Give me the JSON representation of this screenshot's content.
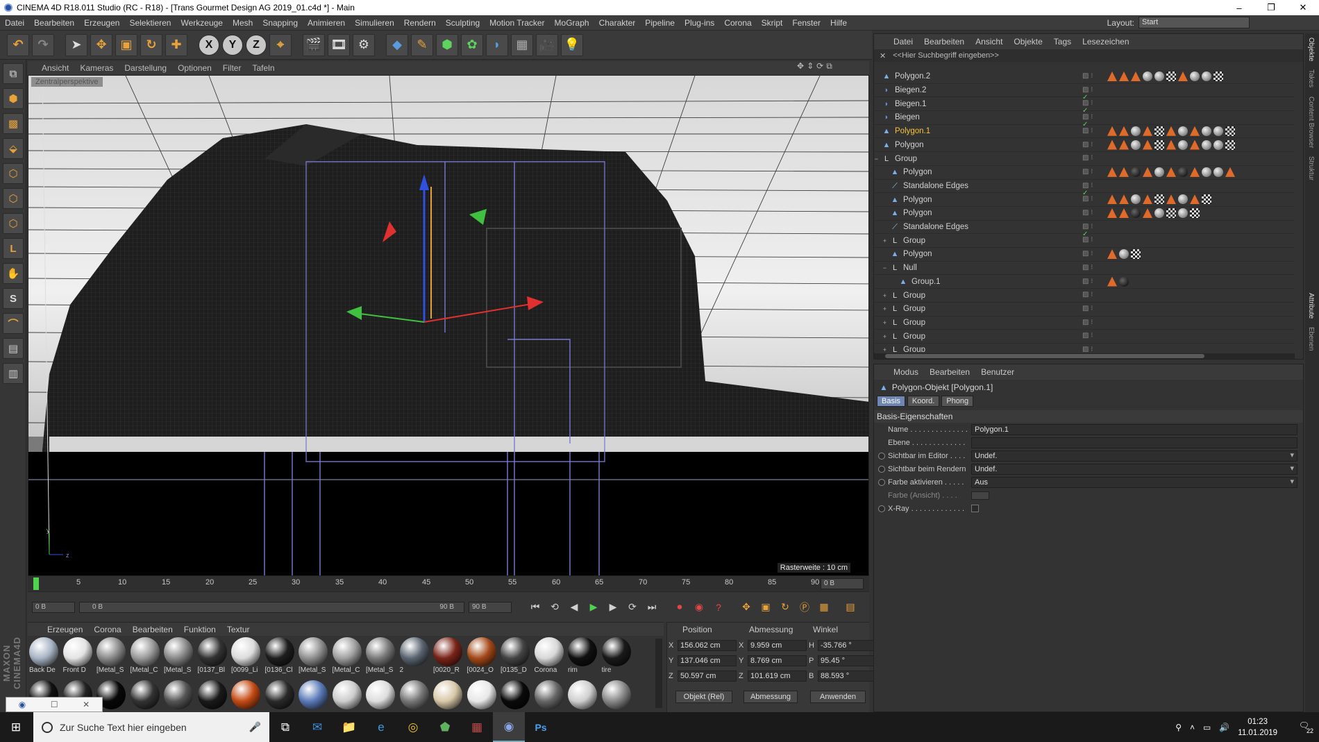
{
  "window": {
    "title": "CINEMA 4D R18.011 Studio (RC - R18) - [Trans Gourmet Design AG 2019_01.c4d *] - Main",
    "minimize": "–",
    "maximize": "❐",
    "close": "✕"
  },
  "menubar": {
    "items": [
      "Datei",
      "Bearbeiten",
      "Erzeugen",
      "Selektieren",
      "Werkzeuge",
      "Mesh",
      "Snapping",
      "Animieren",
      "Simulieren",
      "Rendern",
      "Sculpting",
      "Motion Tracker",
      "MoGraph",
      "Charakter",
      "Pipeline",
      "Plug-ins",
      "Corona",
      "Skript",
      "Fenster",
      "Hilfe"
    ],
    "layout_label": "Layout:",
    "layout_value": "Start"
  },
  "toolbar": {
    "axis_x": "X",
    "axis_y": "Y",
    "axis_z": "Z"
  },
  "viewport": {
    "menu": [
      "Ansicht",
      "Kameras",
      "Darstellung",
      "Optionen",
      "Filter",
      "Tafeln"
    ],
    "label": "Zentralperspektive",
    "raster": "Rasterweite : 10 cm"
  },
  "timeline": {
    "ticks": [
      "0",
      "5",
      "10",
      "15",
      "20",
      "25",
      "30",
      "35",
      "40",
      "45",
      "50",
      "55",
      "60",
      "65",
      "70",
      "75",
      "80",
      "85",
      "90"
    ],
    "frame_end": "0 B",
    "start_field": "0 B",
    "range_start": "0 B",
    "range_end": "90 B",
    "end_field": "90 B"
  },
  "materials": {
    "menu": [
      "Erzeugen",
      "Corona",
      "Bearbeiten",
      "Funktion",
      "Textur"
    ],
    "items": [
      {
        "name": "Back De",
        "color": "#a8b4c4"
      },
      {
        "name": "Front D",
        "color": "#e4e4e4"
      },
      {
        "name": "[Metal_S",
        "color": "#8a8a8a"
      },
      {
        "name": "[Metal_C",
        "color": "#9a9a9a"
      },
      {
        "name": "[Metal_S",
        "color": "#888888"
      },
      {
        "name": "[0137_Bl",
        "color": "#333333"
      },
      {
        "name": "[0099_Li",
        "color": "#dcdcdc"
      },
      {
        "name": "[0136_Cl",
        "color": "#1e1e1e"
      },
      {
        "name": "[Metal_S",
        "color": "#909090"
      },
      {
        "name": "[Metal_C",
        "color": "#a0a0a0"
      },
      {
        "name": "[Metal_S",
        "color": "#7a7a7a"
      },
      {
        "name": "2",
        "color": "#5a6470"
      },
      {
        "name": "[0020_R",
        "color": "#7a2418"
      },
      {
        "name": "[0024_O",
        "color": "#a44818"
      },
      {
        "name": "[0135_D",
        "color": "#444444"
      },
      {
        "name": "Corona",
        "color": "#d8d8d8"
      },
      {
        "name": "rim",
        "color": "#101010"
      },
      {
        "name": "tire",
        "color": "#1a1a1a"
      }
    ],
    "row2_colors": [
      "#111111",
      "#222222",
      "#080808",
      "#333333",
      "#555555",
      "#1a1a1a",
      "#c44a14",
      "#2a2a2a",
      "#5a7ab8",
      "#cccccc",
      "#dddddd",
      "#777777",
      "#d8c8a8",
      "#e8e8e8",
      "#0a0a0a",
      "#666666",
      "#cfcfcf",
      "#888888"
    ]
  },
  "coords": {
    "headers": [
      "Position",
      "Abmessung",
      "Winkel"
    ],
    "rows": [
      {
        "axis": "X",
        "pos": "156.062 cm",
        "size_axis": "X",
        "size": "9.959 cm",
        "rot_axis": "H",
        "rot": "-35.766 °"
      },
      {
        "axis": "Y",
        "pos": "137.046 cm",
        "size_axis": "Y",
        "size": "8.769 cm",
        "rot_axis": "P",
        "rot": "95.45 °"
      },
      {
        "axis": "Z",
        "pos": "50.597 cm",
        "size_axis": "Z",
        "size": "101.619 cm",
        "rot_axis": "B",
        "rot": "88.593 °"
      }
    ],
    "mode": "Objekt (Rel)",
    "size_mode": "Abmessung",
    "apply": "Anwenden"
  },
  "object_manager": {
    "menu": [
      "Datei",
      "Bearbeiten",
      "Ansicht",
      "Objekte",
      "Tags",
      "Lesezeichen"
    ],
    "search_placeholder": "<<Hier Suchbegriff eingeben>>",
    "rows": [
      {
        "name": "Polygon.2",
        "indent": 0,
        "icon": "polygon",
        "check": false,
        "tags": "oooggcoggc"
      },
      {
        "name": "Biegen.2",
        "indent": 0,
        "icon": "deformer",
        "check": true,
        "tags": ""
      },
      {
        "name": "Biegen.1",
        "indent": 0,
        "icon": "deformer",
        "check": true,
        "tags": ""
      },
      {
        "name": "Biegen",
        "indent": 0,
        "icon": "deformer",
        "check": true,
        "tags": ""
      },
      {
        "name": "Polygon.1",
        "indent": 0,
        "icon": "polygon",
        "check": false,
        "tags": "oogocogoggc",
        "selected": true
      },
      {
        "name": "Polygon",
        "indent": 0,
        "icon": "polygon",
        "check": false,
        "tags": "oogocogoggc"
      },
      {
        "name": "Group",
        "indent": 0,
        "icon": "null",
        "expand": "−",
        "check": false,
        "tags": ""
      },
      {
        "name": "Polygon",
        "indent": 1,
        "icon": "polygon",
        "check": false,
        "tags": "oodogodoggo"
      },
      {
        "name": "Standalone Edges",
        "indent": 1,
        "icon": "edges",
        "check": true,
        "tags": ""
      },
      {
        "name": "Polygon",
        "indent": 1,
        "icon": "polygon",
        "check": false,
        "tags": "oogocogoc"
      },
      {
        "name": "Polygon",
        "indent": 1,
        "icon": "polygon",
        "check": false,
        "tags": "oodogcgc"
      },
      {
        "name": "Standalone Edges",
        "indent": 1,
        "icon": "edges",
        "check": true,
        "tags": ""
      },
      {
        "name": "Group",
        "indent": 1,
        "icon": "null",
        "expand": "+",
        "check": false,
        "tags": ""
      },
      {
        "name": "Polygon",
        "indent": 1,
        "icon": "polygon",
        "check": false,
        "tags": "ogc"
      },
      {
        "name": "Null",
        "indent": 1,
        "icon": "null",
        "expand": "−",
        "check": false,
        "tags": ""
      },
      {
        "name": "Group.1",
        "indent": 2,
        "icon": "polygon",
        "check": false,
        "tags": "od"
      },
      {
        "name": "Group",
        "indent": 1,
        "icon": "null",
        "expand": "+",
        "check": false,
        "tags": ""
      },
      {
        "name": "Group",
        "indent": 1,
        "icon": "null",
        "expand": "+",
        "check": false,
        "tags": ""
      },
      {
        "name": "Group",
        "indent": 1,
        "icon": "null",
        "expand": "+",
        "check": false,
        "tags": ""
      },
      {
        "name": "Group",
        "indent": 1,
        "icon": "null",
        "expand": "+",
        "check": false,
        "tags": ""
      },
      {
        "name": "Group",
        "indent": 1,
        "icon": "null",
        "expand": "+",
        "check": false,
        "tags": ""
      }
    ]
  },
  "attributes": {
    "menu": [
      "Modus",
      "Bearbeiten",
      "Benutzer"
    ],
    "title": "Polygon-Objekt [Polygon.1]",
    "tabs": [
      "Basis",
      "Koord.",
      "Phong"
    ],
    "section": "Basis-Eigenschaften",
    "fields": [
      {
        "label": "Name . . . . . . . . . . . . . .",
        "value": "Polygon.1",
        "radio": false,
        "drop": false
      },
      {
        "label": "Ebene . . . . . . . . . . . . .",
        "value": "",
        "radio": false,
        "drop": false
      },
      {
        "label": "Sichtbar im Editor . . . .",
        "value": "Undef.",
        "radio": true,
        "drop": true
      },
      {
        "label": "Sichtbar beim Rendern",
        "value": "Undef.",
        "radio": true,
        "drop": true
      },
      {
        "label": "Farbe aktivieren . . . . .",
        "value": "Aus",
        "radio": true,
        "drop": true
      }
    ],
    "farbe_label": "Farbe (Ansicht) . . . .",
    "xray_label": "X-Ray . . . . . . . . . . . . ."
  },
  "side_tabs": [
    "Objekte",
    "Takes",
    "Content Browser",
    "Struktur",
    "Attribute",
    "Ebenen"
  ],
  "taskbar": {
    "search_placeholder": "Zur Suche Text hier eingeben",
    "time": "01:23",
    "date": "11.01.2019",
    "notifications": "22"
  }
}
